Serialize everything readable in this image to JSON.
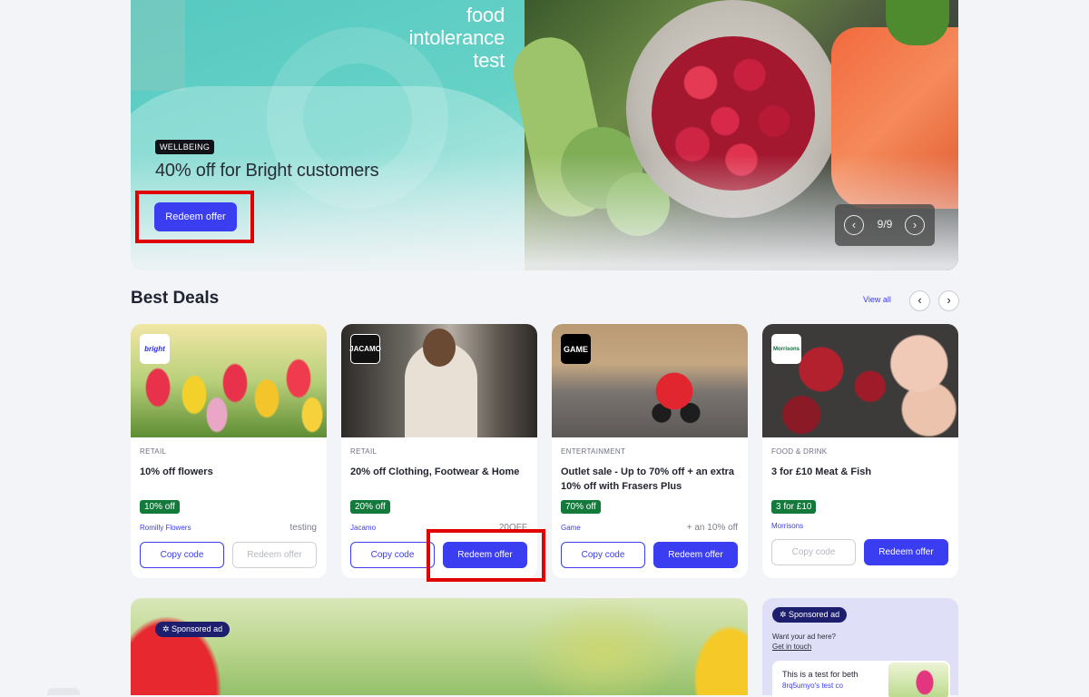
{
  "hero": {
    "brand_line1": "food",
    "brand_line2": "intolerance",
    "brand_line3": "test",
    "badge": "WELLBEING",
    "title": "40% off for Bright customers",
    "cta": "Redeem offer",
    "pager": {
      "prev_icon": "‹",
      "next_icon": "›",
      "count": "9/9"
    }
  },
  "best_deals": {
    "title": "Best Deals",
    "view_all": "View all",
    "prev_icon": "‹",
    "next_icon": "›",
    "cards": [
      {
        "logo": "bright",
        "category": "RETAIL",
        "title": "10% off flowers",
        "pill": "10% off",
        "brand": "Romilly Flowers",
        "extra": "testing",
        "copy_label": "Copy code",
        "redeem_label": "Redeem offer"
      },
      {
        "logo": "JACAMO",
        "category": "RETAIL",
        "title": "20% off Clothing, Footwear & Home",
        "pill": "20% off",
        "brand": "Jacamo",
        "extra": "20OFF",
        "copy_label": "Copy code",
        "redeem_label": "Redeem offer"
      },
      {
        "logo": "GAME",
        "category": "ENTERTAINMENT",
        "title": "Outlet sale - Up to 70% off + an extra 10% off with Frasers Plus",
        "pill": "70% off",
        "brand": "Game",
        "extra": "+ an 10% off",
        "copy_label": "Copy code",
        "redeem_label": "Redeem offer"
      },
      {
        "logo": "Morrisons",
        "category": "FOOD & DRINK",
        "title": "3 for £10 Meat & Fish",
        "pill": "3 for £10",
        "brand": "Morrisons",
        "extra": "",
        "copy_label": "Copy code",
        "redeem_label": "Redeem offer"
      }
    ]
  },
  "sponsored": {
    "badge": "Sponsored ad",
    "ad_question": "Want your ad here?",
    "ad_link": "Get in touch",
    "ad_card_title": "This is a test for beth",
    "ad_card_subtitle": "8rq5umyo's test co"
  },
  "colors": {
    "accent": "#3b3df0",
    "pill_green": "#137a3c",
    "highlight": "#e00000",
    "badge_dark": "#1d1f6e"
  }
}
